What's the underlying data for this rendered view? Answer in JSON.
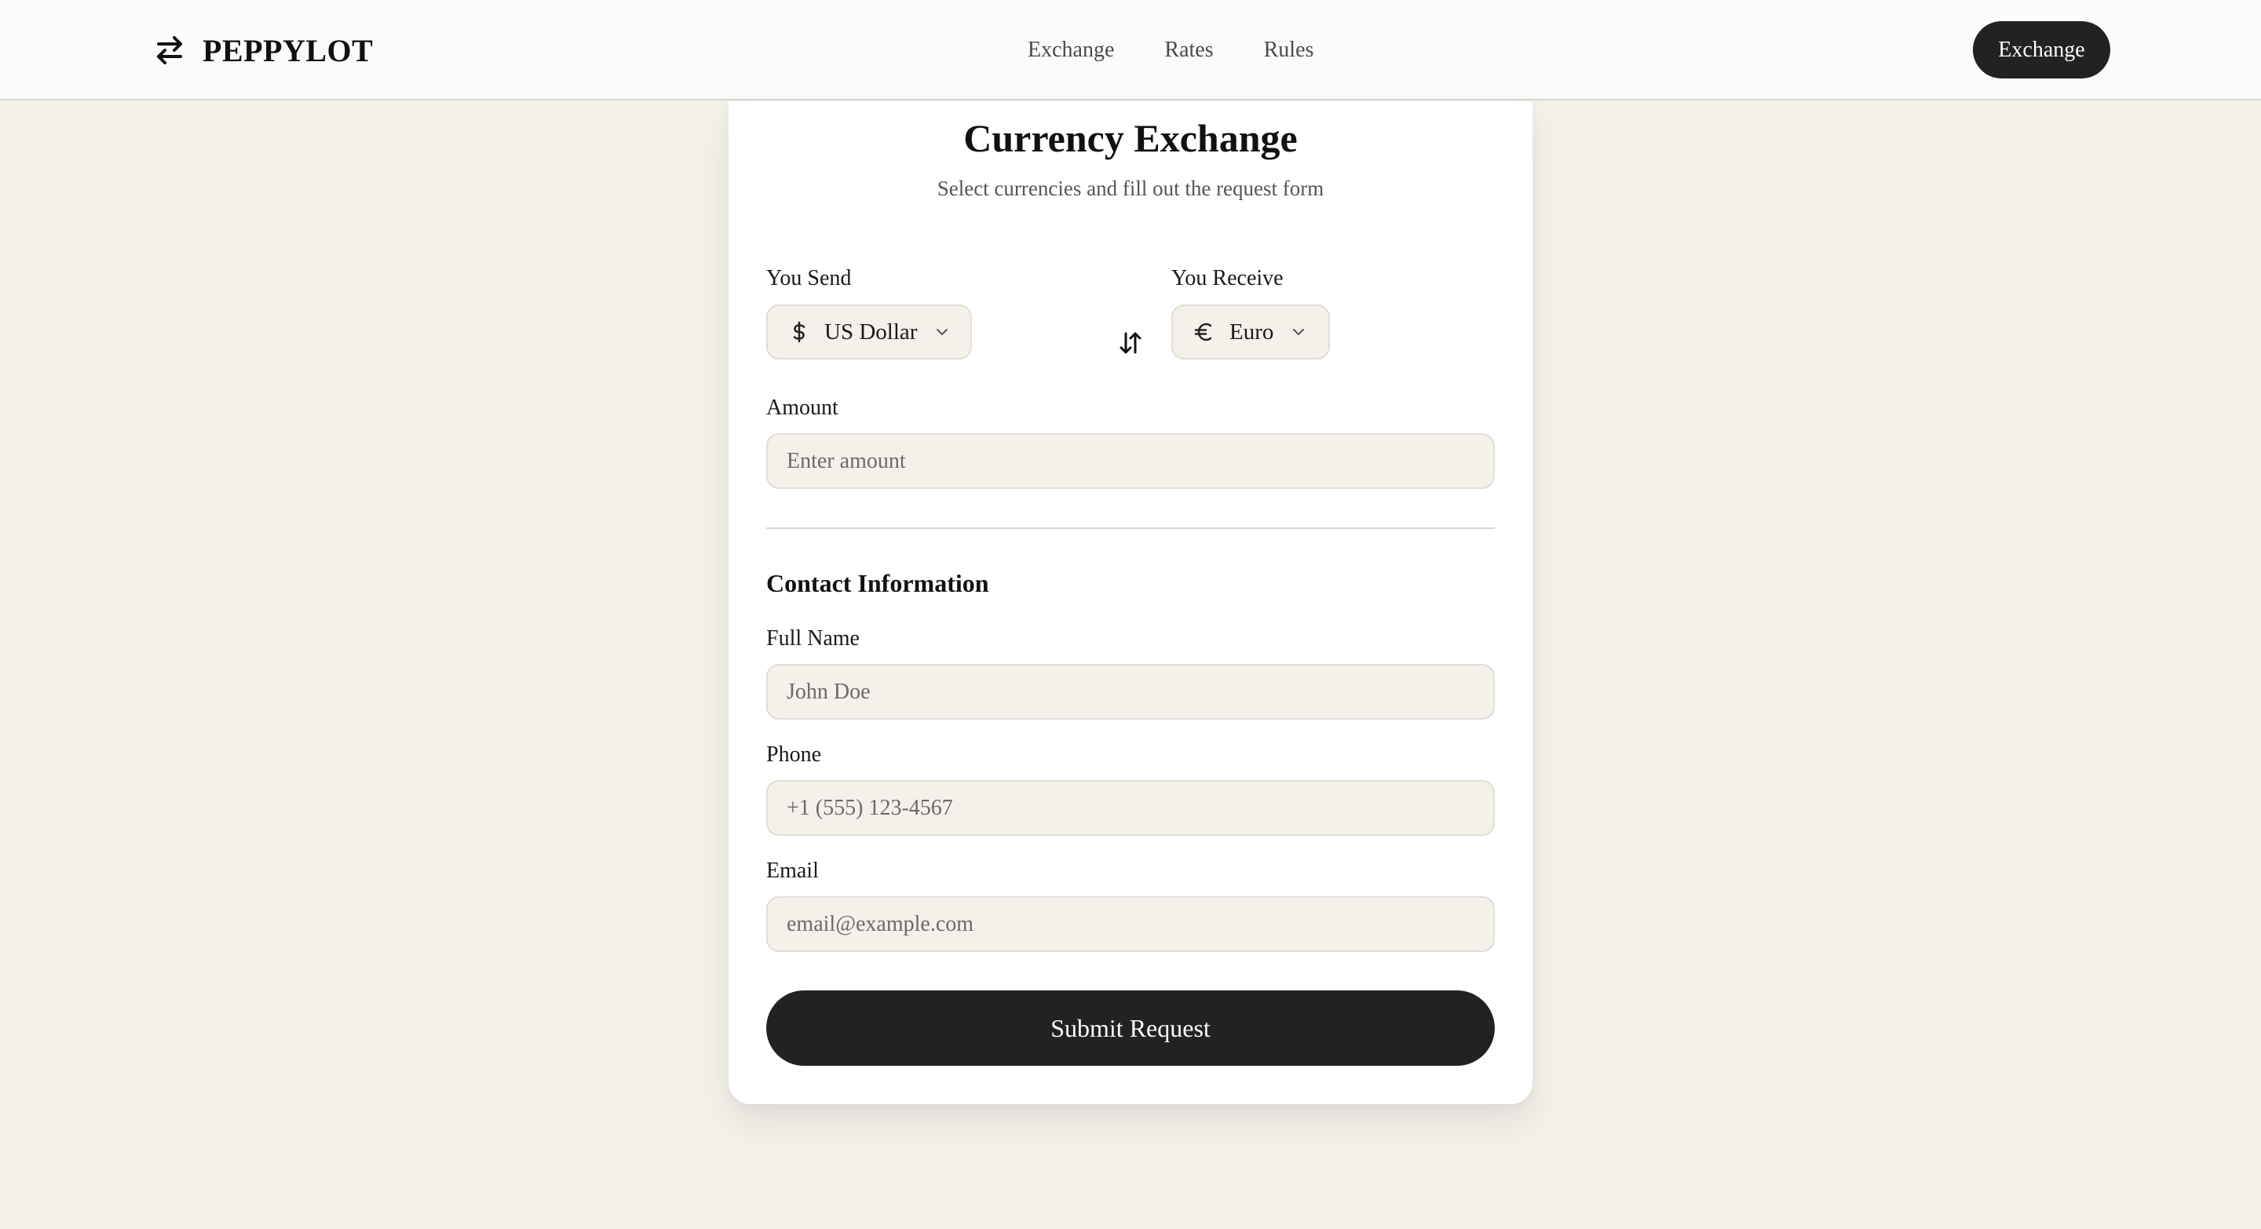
{
  "header": {
    "brand": "PEPPYLOT",
    "brand_icon": "swap-arrows-icon",
    "nav": [
      "Exchange",
      "Rates",
      "Rules"
    ],
    "cta_label": "Exchange"
  },
  "form": {
    "title": "Currency Exchange",
    "subtitle": "Select currencies and fill out the request form",
    "send_label": "You Send",
    "send_currency": "US Dollar",
    "send_icon": "dollar-icon",
    "receive_label": "You Receive",
    "receive_currency": "Euro",
    "receive_icon": "euro-icon",
    "swap_icon": "swap-vertical-icon",
    "amount_label": "Amount",
    "amount_placeholder": "Enter amount",
    "contact_title": "Contact Information",
    "name_label": "Full Name",
    "name_placeholder": "John Doe",
    "phone_label": "Phone",
    "phone_placeholder": "+1 (555) 123-4567",
    "email_label": "Email",
    "email_placeholder": "email@example.com",
    "submit_label": "Submit Request"
  },
  "colors": {
    "background": "#f4f0ea",
    "primary": "#222222",
    "card": "#ffffff"
  }
}
